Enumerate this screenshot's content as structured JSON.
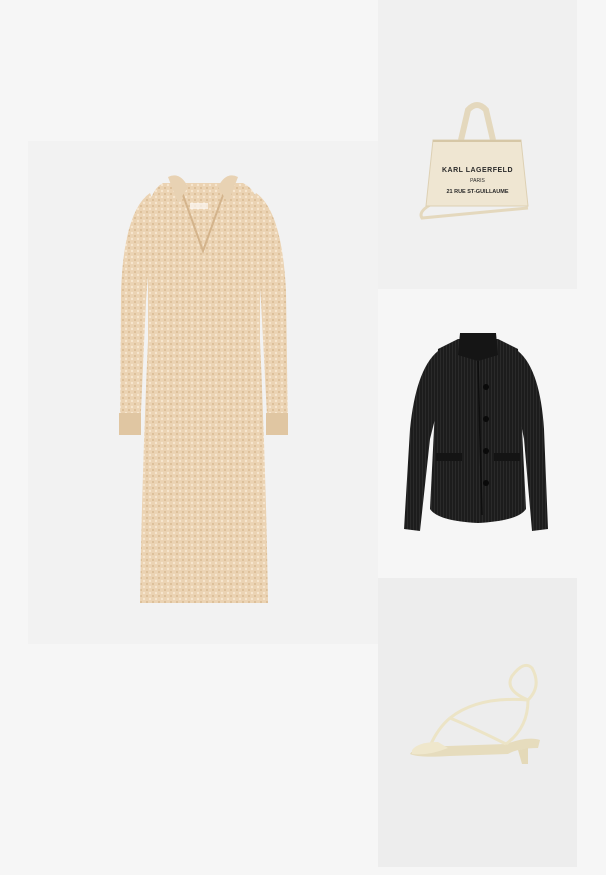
{
  "products": [
    {
      "id": "dress",
      "description_icon": "knit-dress-icon",
      "color": "#e8cfae"
    },
    {
      "id": "bag",
      "description_icon": "tote-bag-icon",
      "color": "#efe6d2",
      "print": {
        "line1": "KARL LAGERFELD",
        "line2": "PARIS",
        "line3": "21 RUE ST-GUILLAUME"
      }
    },
    {
      "id": "jacket",
      "description_icon": "corduroy-jacket-icon",
      "color": "#1c1c1c"
    },
    {
      "id": "sandal",
      "description_icon": "strappy-sandal-icon",
      "color": "#ece4c6"
    }
  ]
}
